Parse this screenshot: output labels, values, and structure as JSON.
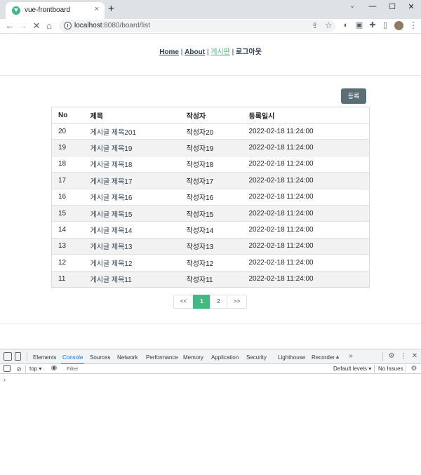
{
  "browser": {
    "tab_title": "vue-frontboard",
    "tab_close": "×",
    "new_tab": "+",
    "url_host": "localhost",
    "url_rest": ":8080/board/list",
    "controls": {
      "tab_search": "⌄",
      "minimize": "—",
      "maximize": "☐",
      "close": "✕"
    },
    "nav": {
      "back": "←",
      "forward": "→",
      "reload_stop": "✕",
      "home": "⌂"
    }
  },
  "app": {
    "nav": {
      "home": "Home",
      "sep1": " | ",
      "about": "About",
      "sep2": " | ",
      "board": "게시판",
      "sep3": " | ",
      "logout": "로그아웃"
    },
    "register_label": "등록",
    "table": {
      "headers": [
        "No",
        "제목",
        "작성자",
        "등록일시"
      ],
      "rows": [
        {
          "no": "20",
          "title": "게시글 제목201",
          "writer": "작성자20",
          "date": "2022-02-18 11:24:00"
        },
        {
          "no": "19",
          "title": "게시글 제목19",
          "writer": "작성자19",
          "date": "2022-02-18 11:24:00"
        },
        {
          "no": "18",
          "title": "게시글 제목18",
          "writer": "작성자18",
          "date": "2022-02-18 11:24:00"
        },
        {
          "no": "17",
          "title": "게시글 제목17",
          "writer": "작성자17",
          "date": "2022-02-18 11:24:00"
        },
        {
          "no": "16",
          "title": "게시글 제목16",
          "writer": "작성자16",
          "date": "2022-02-18 11:24:00"
        },
        {
          "no": "15",
          "title": "게시글 제목15",
          "writer": "작성자15",
          "date": "2022-02-18 11:24:00"
        },
        {
          "no": "14",
          "title": "게시글 제목14",
          "writer": "작성자14",
          "date": "2022-02-18 11:24:00"
        },
        {
          "no": "13",
          "title": "게시글 제목13",
          "writer": "작성자13",
          "date": "2022-02-18 11:24:00"
        },
        {
          "no": "12",
          "title": "게시글 제목12",
          "writer": "작성자12",
          "date": "2022-02-18 11:24:00"
        },
        {
          "no": "11",
          "title": "게시글 제목11",
          "writer": "작성자11",
          "date": "2022-02-18 11:24:00"
        }
      ]
    },
    "pagination": {
      "first": "<<",
      "pages": [
        "1",
        "2"
      ],
      "current": "1",
      "last": ">>"
    },
    "colors": {
      "accent": "#42b983",
      "button": "#5a6e78",
      "text": "#2c3e50"
    }
  },
  "devtools": {
    "tabs": [
      "Elements",
      "Console",
      "Sources",
      "Network",
      "Performance",
      "Memory",
      "Application",
      "Security",
      "Lighthouse",
      "Recorder"
    ],
    "active_tab": "Console",
    "more_tabs": "»",
    "context": "top",
    "filter_placeholder": "Filter",
    "levels": "Default levels",
    "issues": "No Issues",
    "prompt": "›"
  }
}
